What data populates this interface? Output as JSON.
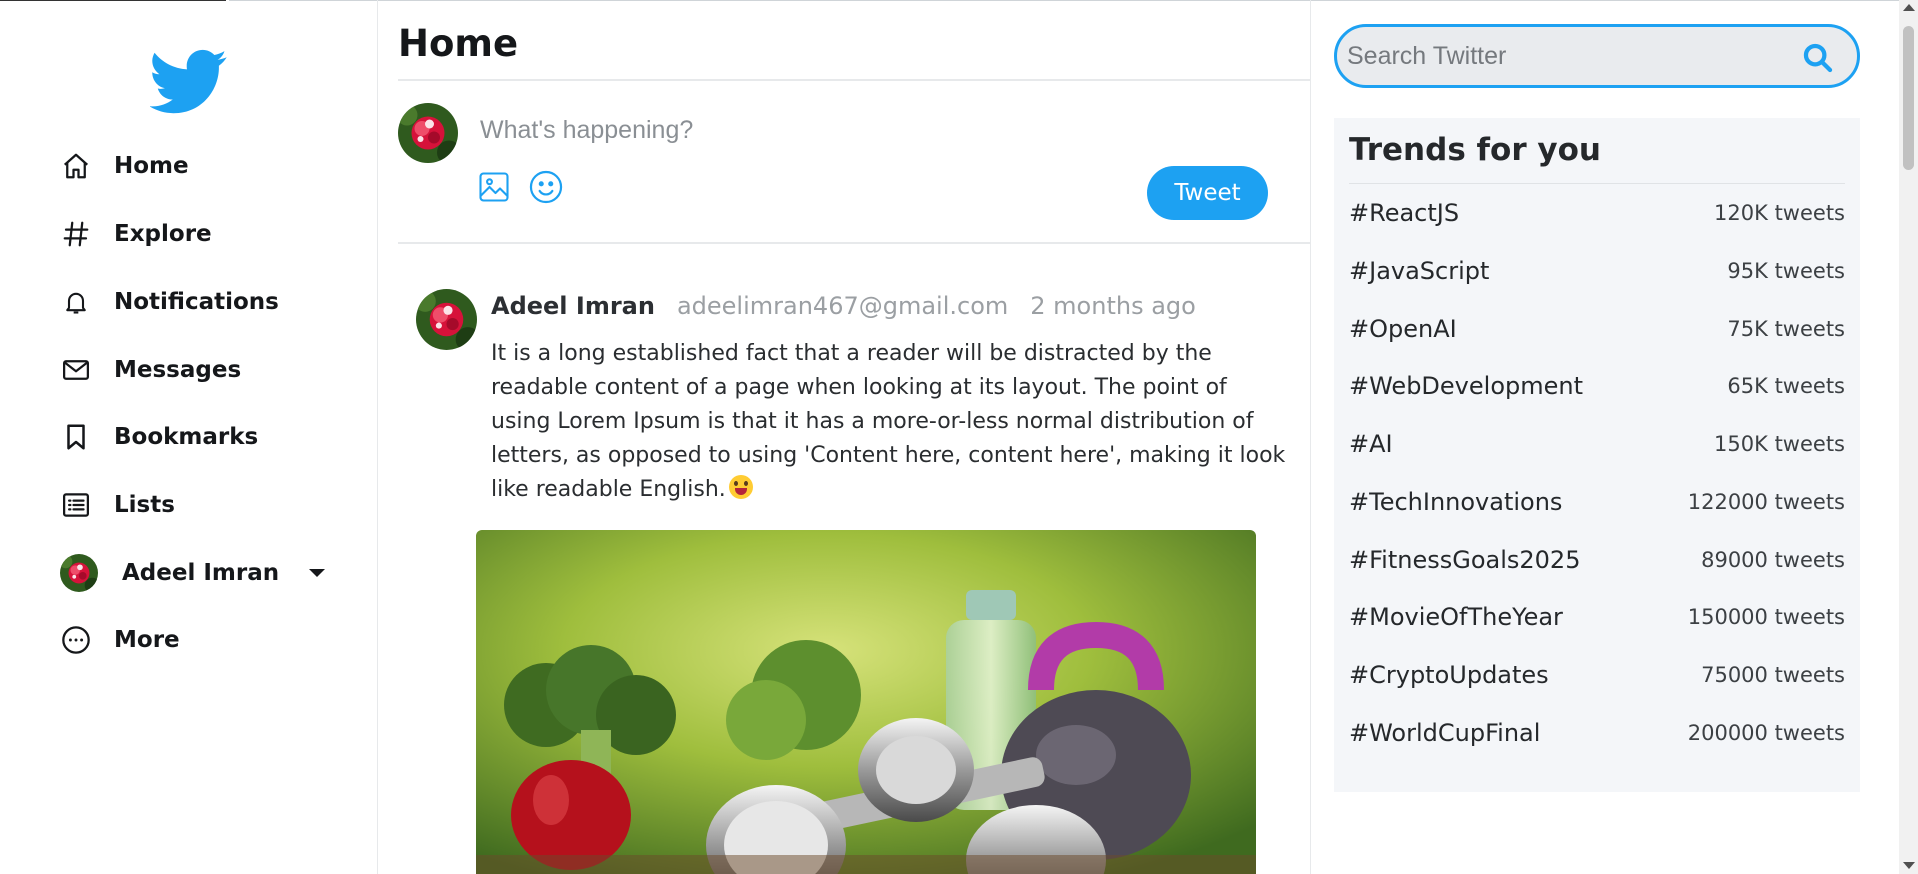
{
  "brand": {
    "logo_icon": "twitter-bird-icon",
    "accent_color": "#1da1f2"
  },
  "sidebar": {
    "items": [
      {
        "label": "Home",
        "icon": "home-icon"
      },
      {
        "label": "Explore",
        "icon": "hashtag-icon"
      },
      {
        "label": "Notifications",
        "icon": "bell-icon"
      },
      {
        "label": "Messages",
        "icon": "envelope-icon"
      },
      {
        "label": "Bookmarks",
        "icon": "bookmark-icon"
      },
      {
        "label": "Lists",
        "icon": "list-icon"
      }
    ],
    "profile": {
      "name": "Adeel Imran",
      "icon": "chevron-down-icon"
    },
    "more": {
      "label": "More",
      "icon": "more-circle-icon"
    }
  },
  "main": {
    "title": "Home",
    "composer": {
      "placeholder": "What's happening?",
      "tools": [
        "image-icon",
        "emoji-icon"
      ],
      "tweet_button": "Tweet"
    },
    "posts": [
      {
        "author": "Adeel Imran",
        "email": "adeelimran467@gmail.com",
        "time": "2 months ago",
        "text": "It is a long established fact that a reader will be distracted by the readable content of a page when looking at its layout. The point of using Lorem Ipsum is that it has a more-or-less normal distribution of letters, as opposed to using 'Content here, content here', making it look like readable English.",
        "image": "fitness-vegetables-dumbbells-photo"
      }
    ]
  },
  "search": {
    "placeholder": "Search Twitter",
    "icon": "search-icon"
  },
  "trends": {
    "title": "Trends for you",
    "items": [
      {
        "tag": "#ReactJS",
        "count": "120K tweets"
      },
      {
        "tag": "#JavaScript",
        "count": "95K tweets"
      },
      {
        "tag": "#OpenAI",
        "count": "75K tweets"
      },
      {
        "tag": "#WebDevelopment",
        "count": "65K tweets"
      },
      {
        "tag": "#AI",
        "count": "150K tweets"
      },
      {
        "tag": "#TechInnovations",
        "count": "122000 tweets"
      },
      {
        "tag": "#FitnessGoals2025",
        "count": "89000 tweets"
      },
      {
        "tag": "#MovieOfTheYear",
        "count": "150000 tweets"
      },
      {
        "tag": "#CryptoUpdates",
        "count": "75000 tweets"
      },
      {
        "tag": "#WorldCupFinal",
        "count": "200000 tweets"
      }
    ]
  }
}
